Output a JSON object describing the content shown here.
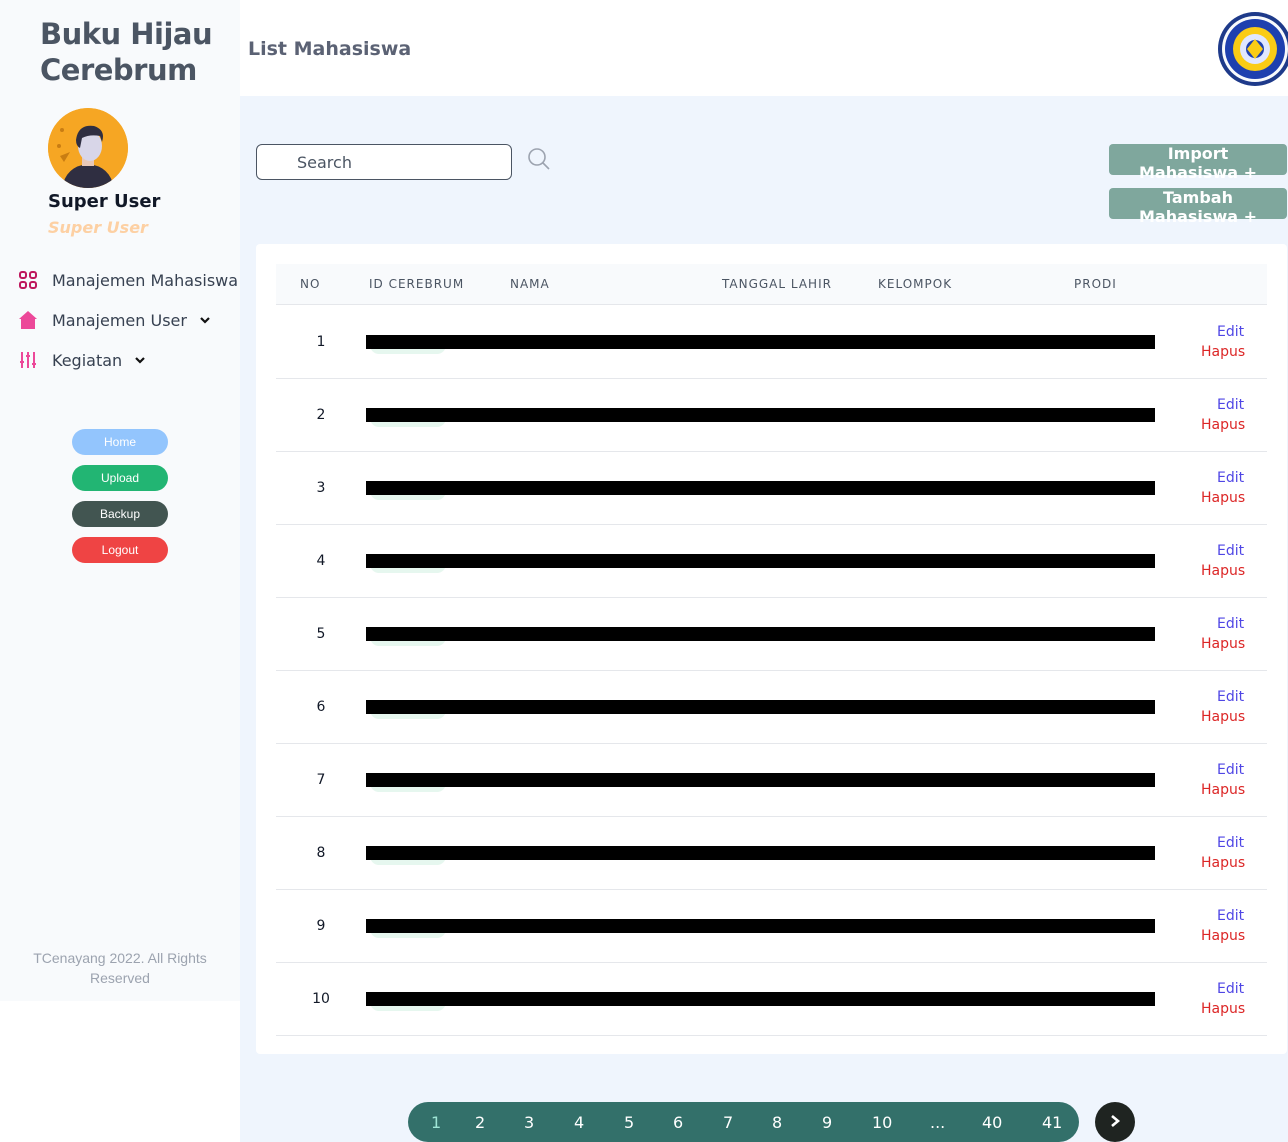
{
  "brand": {
    "title": "Buku Hijau Cerebrum"
  },
  "user": {
    "name": "Super User",
    "role": "Super User"
  },
  "nav": [
    {
      "label": "Manajemen Mahasiswa",
      "icon": "grid-icon"
    },
    {
      "label": "Manajemen User",
      "icon": "home-icon",
      "has_dropdown": true
    },
    {
      "label": "Kegiatan",
      "icon": "sliders-icon",
      "has_dropdown": true
    }
  ],
  "sidebar_buttons": {
    "home": "Home",
    "upload": "Upload",
    "backup": "Backup",
    "logout": "Logout"
  },
  "footer": {
    "text": "TCenayang 2022. All Rights Reserved"
  },
  "header": {
    "title": "List Mahasiswa",
    "logo": "university-seal-logo"
  },
  "search": {
    "placeholder": "Search"
  },
  "actions": {
    "import": "Import Mahasiswa +",
    "tambah": "Tambah Mahasiswa +"
  },
  "table": {
    "columns": [
      "NO",
      "ID CEREBRUM",
      "NAMA",
      "TANGGAL LAHIR",
      "KELOMPOK",
      "PRODI"
    ],
    "rows": [
      {
        "no": "1",
        "edit": "Edit",
        "delete": "Hapus"
      },
      {
        "no": "2",
        "edit": "Edit",
        "delete": "Hapus"
      },
      {
        "no": "3",
        "edit": "Edit",
        "delete": "Hapus"
      },
      {
        "no": "4",
        "edit": "Edit",
        "delete": "Hapus"
      },
      {
        "no": "5",
        "edit": "Edit",
        "delete": "Hapus"
      },
      {
        "no": "6",
        "edit": "Edit",
        "delete": "Hapus"
      },
      {
        "no": "7",
        "edit": "Edit",
        "delete": "Hapus"
      },
      {
        "no": "8",
        "edit": "Edit",
        "delete": "Hapus"
      },
      {
        "no": "9",
        "edit": "Edit",
        "delete": "Hapus"
      },
      {
        "no": "10",
        "edit": "Edit",
        "delete": "Hapus"
      }
    ]
  },
  "pagination": {
    "pages": [
      "1",
      "2",
      "3",
      "4",
      "5",
      "6",
      "7",
      "8",
      "9",
      "10",
      "...",
      "40",
      "41"
    ],
    "current": "1",
    "next_icon": "chevron-right-icon"
  },
  "colors": {
    "accent": "#7fa79d",
    "pagination_bg": "#33706a",
    "edit": "#4f46e5",
    "delete": "#dc2626",
    "home_button": "#93c5fd",
    "upload_button": "#22b573",
    "backup_button": "#425551",
    "logout_button": "#ef4444"
  }
}
